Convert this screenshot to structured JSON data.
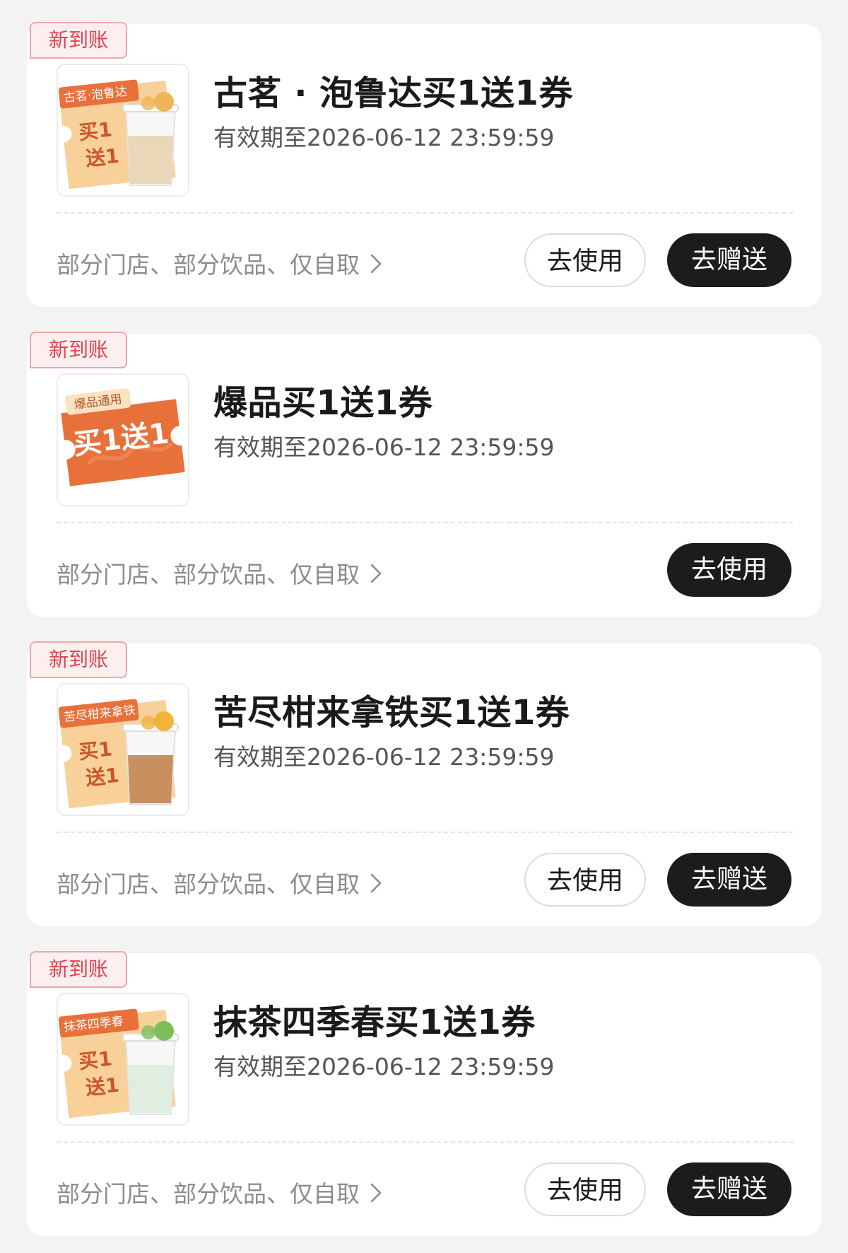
{
  "coupons": [
    {
      "badge": "新到账",
      "thumb": {
        "style": "cup",
        "tag": "古茗·泡鲁达",
        "line1": "买1",
        "line2": "送1",
        "drink_color": "#e9d7b8",
        "topping_color": "#f0b45a"
      },
      "title": "古茗 · 泡鲁达买1送1券",
      "expiry": "有效期至2026-06-12 23:59:59",
      "conditions": "部分门店、部分饮品、仅自取",
      "use_label": "去使用",
      "gift_label": "去赠送"
    },
    {
      "badge": "新到账",
      "thumb": {
        "style": "ticket",
        "tag": "爆品通用",
        "line1": "买1送1",
        "line2": "",
        "drink_color": "",
        "topping_color": ""
      },
      "title": "爆品买1送1券",
      "expiry": "有效期至2026-06-12 23:59:59",
      "conditions": "部分门店、部分饮品、仅自取",
      "use_label": "去使用"
    },
    {
      "badge": "新到账",
      "thumb": {
        "style": "cup",
        "tag": "苦尽柑来拿铁",
        "line1": "买1",
        "line2": "送1",
        "drink_color": "#c98f5e",
        "topping_color": "#f2b33a"
      },
      "title": "苦尽柑来拿铁买1送1券",
      "expiry": "有效期至2026-06-12 23:59:59",
      "conditions": "部分门店、部分饮品、仅自取",
      "use_label": "去使用",
      "gift_label": "去赠送"
    },
    {
      "badge": "新到账",
      "thumb": {
        "style": "cup",
        "tag": "抹茶四季春",
        "line1": "买1",
        "line2": "送1",
        "drink_color": "#dfeee0",
        "topping_color": "#7bbf5a"
      },
      "title": "抹茶四季春买1送1券",
      "expiry": "有效期至2026-06-12 23:59:59",
      "conditions": "部分门店、部分饮品、仅自取",
      "use_label": "去使用",
      "gift_label": "去赠送"
    }
  ],
  "colors": {
    "badge_text": "#e0434f",
    "badge_border": "#f0a6ac",
    "ticket_orange": "#e8703a",
    "ticket_cream": "#f8d19a",
    "dark_button": "#1c1c1c"
  },
  "icons": {
    "conditions_chevron": "chevron-right-icon"
  }
}
